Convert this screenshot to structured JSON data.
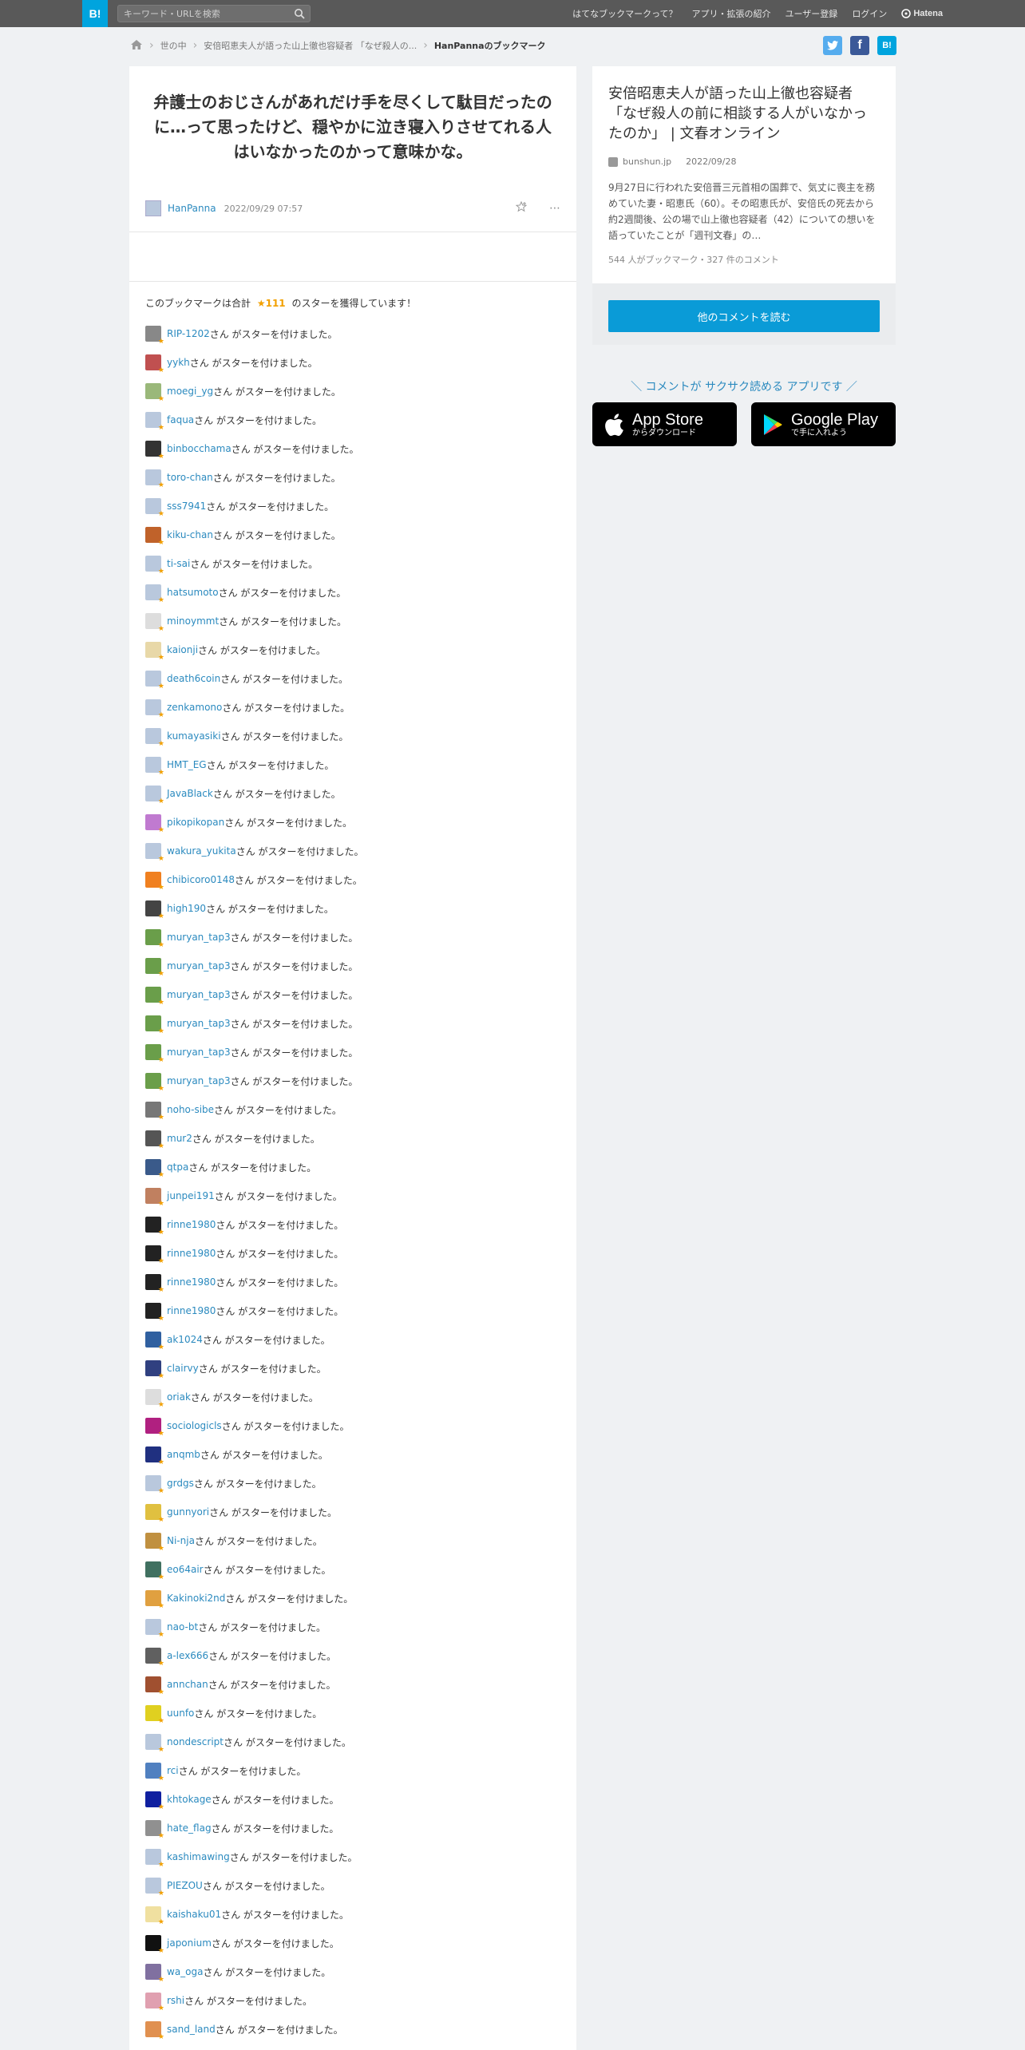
{
  "header": {
    "logo": "B!",
    "search_placeholder": "キーワード・URLを検索",
    "nav": [
      "はてなブックマークって？",
      "アプリ・拡張の紹介",
      "ユーザー登録",
      "ログイン"
    ],
    "brand": "Hatena"
  },
  "breadcrumb": {
    "items": [
      "世の中",
      "安倍昭恵夫人が語った山上徹也容疑者 「なぜ殺人の...",
      "HanPannaのブックマーク"
    ]
  },
  "share": {
    "twitter": "t",
    "facebook": "f",
    "hatena": "B!"
  },
  "bookmark": {
    "comment": "弁護士のおじさんがあれだけ手を尽くして駄目だったのに…って思ったけど、穏やかに泣き寝入りさせてれる人はいなかったのかって意味かな。",
    "user": "HanPanna",
    "date": "2022/09/29 07:57",
    "stars_prefix": "このブックマークは合計",
    "stars_count": "★111",
    "stars_suffix": "のスターを獲得しています！",
    "star_suffix_text": "さん がスターを付けました。"
  },
  "star_users": [
    "RIP-1202",
    "yykh",
    "moegi_yg",
    "faqua",
    "binbocchama",
    "toro-chan",
    "sss7941",
    "kiku-chan",
    "ti-sai",
    "hatsumoto",
    "minoymmt",
    "kaionji",
    "death6coin",
    "zenkamono",
    "kumayasiki",
    "HMT_EG",
    "JavaBlack",
    "pikopikopan",
    "wakura_yukita",
    "chibicoro0148",
    "high190",
    "muryan_tap3",
    "muryan_tap3",
    "muryan_tap3",
    "muryan_tap3",
    "muryan_tap3",
    "muryan_tap3",
    "noho-sibe",
    "mur2",
    "qtpa",
    "junpei191",
    "rinne1980",
    "rinne1980",
    "rinne1980",
    "rinne1980",
    "ak1024",
    "clairvy",
    "oriak",
    "sociologicls",
    "anqmb",
    "grdgs",
    "gunnyori",
    "Ni-nja",
    "eo64air",
    "Kakinoki2nd",
    "nao-bt",
    "a-lex666",
    "annchan",
    "uunfo",
    "nondescript",
    "rci",
    "khtokage",
    "hate_flag",
    "kashimawing",
    "PIEZOU",
    "kaishaku01",
    "japonium",
    "wa_oga",
    "rshi",
    "sand_land"
  ],
  "avatar_colors": [
    "#888888",
    "#c05050",
    "#9ab87a",
    "#b9c8dd",
    "#333333",
    "#b9c8dd",
    "#b9c8dd",
    "#c0622a",
    "#b9c8dd",
    "#b9c8dd",
    "#dddddd",
    "#e8d8a8",
    "#b9c8dd",
    "#b9c8dd",
    "#b9c8dd",
    "#b9c8dd",
    "#b9c8dd",
    "#c07ad0",
    "#b9c8dd",
    "#f08020",
    "#444444",
    "#6a9e4a",
    "#6a9e4a",
    "#6a9e4a",
    "#6a9e4a",
    "#6a9e4a",
    "#6a9e4a",
    "#777777",
    "#555555",
    "#3a5a8a",
    "#c08060",
    "#222222",
    "#222222",
    "#222222",
    "#222222",
    "#3060a0",
    "#304080",
    "#dddddd",
    "#b02080",
    "#203080",
    "#b9c8dd",
    "#e0c040",
    "#c09040",
    "#407060",
    "#e0a040",
    "#b9c8dd",
    "#606060",
    "#a05030",
    "#e0d020",
    "#b9c8dd",
    "#5080c0",
    "#1020a0",
    "#909090",
    "#b9c8dd",
    "#b9c8dd",
    "#f0e0a0",
    "#111111",
    "#8070a0",
    "#e0a0b0",
    "#e09050"
  ],
  "entry": {
    "title": "安倍昭恵夫人が語った山上徹也容疑者「なぜ殺人の前に相談する人がいなかったのか」 | 文春オンライン",
    "domain": "bunshun.jp",
    "date": "2022/09/28",
    "summary": "9月27日に行われた安倍晋三元首相の国葬で、気丈に喪主を務めていた妻・昭恵氏（60）。その昭恵氏が、安倍氏の死去から約2週間後、公の場で山上徹也容疑者（42）についての想いを語っていたことが「週刊文春」の…",
    "counts": "544 人がブックマーク・327 件のコメント",
    "cta": "他のコメントを読む"
  },
  "app": {
    "lead": "＼ コメントが サクサク読める アプリです ／",
    "appstore_name": "App Store",
    "appstore_sub": "からダウンロード",
    "googleplay_name": "Google Play",
    "googleplay_sub": "で手に入れよう"
  }
}
